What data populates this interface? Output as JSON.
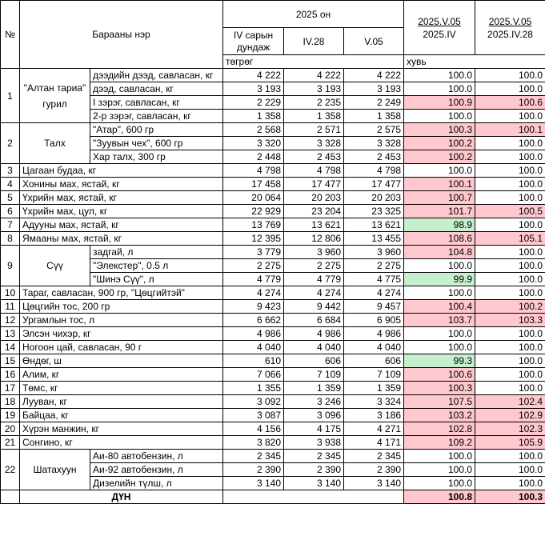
{
  "header": {
    "no": "№",
    "product": "Барааны нэр",
    "year": "2025 он",
    "col_avg": "IV сарын дундаж",
    "col_apr28": "IV.28",
    "col_may05": "V.05",
    "unit_tugrug": "төгрөг",
    "pct1_top": "2025.V.05",
    "pct1_bottom": "2025.IV",
    "pct2_top": "2025.V.05",
    "pct2_bottom": "2025.IV.28",
    "unit_pct": "хувь"
  },
  "groups": {
    "g1_no": "1",
    "g1_name": "\"Алтан тариа\" гурил",
    "g2_no": "2",
    "g2_name": "Талх",
    "g9_no": "9",
    "g9_name": "Сүү",
    "g22_no": "22",
    "g22_name": "Шатахуун"
  },
  "rows": [
    {
      "no": "",
      "name": "дээдийн дээд, савласан, кг",
      "avg": "4 222",
      "apr28": "4 222",
      "may05": "4 222",
      "p1": "100.0",
      "p2": "100.0",
      "c1": "",
      "c2": ""
    },
    {
      "no": "",
      "name": "дээд, савласан, кг",
      "avg": "3 193",
      "apr28": "3 193",
      "may05": "3 193",
      "p1": "100.0",
      "p2": "100.0",
      "c1": "",
      "c2": ""
    },
    {
      "no": "",
      "name": "I зэрэг, савласан, кг",
      "avg": "2 229",
      "apr28": "2 235",
      "may05": "2 249",
      "p1": "100.9",
      "p2": "100.6",
      "c1": "red",
      "c2": "red"
    },
    {
      "no": "",
      "name": "2-р зэрэг, савласан, кг",
      "avg": "1 358",
      "apr28": "1 358",
      "may05": "1 358",
      "p1": "100.0",
      "p2": "100.0",
      "c1": "",
      "c2": ""
    },
    {
      "no": "",
      "name": "\"Атар\", 600 гр",
      "avg": "2 568",
      "apr28": "2 571",
      "may05": "2 575",
      "p1": "100.3",
      "p2": "100.1",
      "c1": "red",
      "c2": "red"
    },
    {
      "no": "",
      "name": "\"Зуувын чех\", 600 гр",
      "avg": "3 320",
      "apr28": "3 328",
      "may05": "3 328",
      "p1": "100.2",
      "p2": "100.0",
      "c1": "red",
      "c2": ""
    },
    {
      "no": "",
      "name": "Хар талх, 300 гр",
      "avg": "2 448",
      "apr28": "2 453",
      "may05": "2 453",
      "p1": "100.2",
      "p2": "100.0",
      "c1": "red",
      "c2": ""
    },
    {
      "no": "3",
      "name": "Цагаан будаа, кг",
      "avg": "4 798",
      "apr28": "4 798",
      "may05": "4 798",
      "p1": "100.0",
      "p2": "100.0",
      "c1": "",
      "c2": ""
    },
    {
      "no": "4",
      "name": "Хонины мах, ястай, кг",
      "avg": "17 458",
      "apr28": "17 477",
      "may05": "17 477",
      "p1": "100.1",
      "p2": "100.0",
      "c1": "red",
      "c2": ""
    },
    {
      "no": "5",
      "name": "Үхрийн мах, ястай, кг",
      "avg": "20 064",
      "apr28": "20 203",
      "may05": "20 203",
      "p1": "100.7",
      "p2": "100.0",
      "c1": "red",
      "c2": ""
    },
    {
      "no": "6",
      "name": "Үхрийн мах, цул, кг",
      "avg": "22 929",
      "apr28": "23 204",
      "may05": "23 325",
      "p1": "101.7",
      "p2": "100.5",
      "c1": "red",
      "c2": "red"
    },
    {
      "no": "7",
      "name": "Адууны мах, ястай, кг",
      "avg": "13 769",
      "apr28": "13 621",
      "may05": "13 621",
      "p1": "98.9",
      "p2": "100.0",
      "c1": "green",
      "c2": ""
    },
    {
      "no": "8",
      "name": "Ямааны мах, ястай, кг",
      "avg": "12 395",
      "apr28": "12 806",
      "may05": "13 455",
      "p1": "108.6",
      "p2": "105.1",
      "c1": "red",
      "c2": "red"
    },
    {
      "no": "",
      "name": "задгай, л",
      "avg": "3 779",
      "apr28": "3 960",
      "may05": "3 960",
      "p1": "104.8",
      "p2": "100.0",
      "c1": "red",
      "c2": ""
    },
    {
      "no": "",
      "name": "\"Элекстер\", 0.5 л",
      "avg": "2 275",
      "apr28": "2 275",
      "may05": "2 275",
      "p1": "100.0",
      "p2": "100.0",
      "c1": "",
      "c2": ""
    },
    {
      "no": "",
      "name": "\"Шинэ Сүү\", л",
      "avg": "4 779",
      "apr28": "4 779",
      "may05": "4 775",
      "p1": "99.9",
      "p2": "100.0",
      "c1": "green",
      "c2": ""
    },
    {
      "no": "10",
      "name": "Тараг, савласан, 900 гр, \"Цөцгийтэй\"",
      "avg": "4 274",
      "apr28": "4 274",
      "may05": "4 274",
      "p1": "100.0",
      "p2": "100.0",
      "c1": "",
      "c2": ""
    },
    {
      "no": "11",
      "name": "Цөцгийн тос, 200 гр",
      "avg": "9 423",
      "apr28": "9 442",
      "may05": "9 457",
      "p1": "100.4",
      "p2": "100.2",
      "c1": "red",
      "c2": "red"
    },
    {
      "no": "12",
      "name": "Ургамлын тос, л",
      "avg": "6 662",
      "apr28": "6 684",
      "may05": "6 905",
      "p1": "103.7",
      "p2": "103.3",
      "c1": "red",
      "c2": "red"
    },
    {
      "no": "13",
      "name": "Элсэн чихэр, кг",
      "avg": "4 986",
      "apr28": "4 986",
      "may05": "4 986",
      "p1": "100.0",
      "p2": "100.0",
      "c1": "",
      "c2": ""
    },
    {
      "no": "14",
      "name": "Ногоон цай, савласан, 90 г",
      "avg": "4 040",
      "apr28": "4 040",
      "may05": "4 040",
      "p1": "100.0",
      "p2": "100.0",
      "c1": "",
      "c2": ""
    },
    {
      "no": "15",
      "name": "Өндөг, ш",
      "avg": "610",
      "apr28": "606",
      "may05": "606",
      "p1": "99.3",
      "p2": "100.0",
      "c1": "green",
      "c2": ""
    },
    {
      "no": "16",
      "name": "Алим, кг",
      "avg": "7 066",
      "apr28": "7 109",
      "may05": "7 109",
      "p1": "100.6",
      "p2": "100.0",
      "c1": "red",
      "c2": ""
    },
    {
      "no": "17",
      "name": "Төмс, кг",
      "avg": "1 355",
      "apr28": "1 359",
      "may05": "1 359",
      "p1": "100.3",
      "p2": "100.0",
      "c1": "red",
      "c2": ""
    },
    {
      "no": "18",
      "name": "Лууван, кг",
      "avg": "3 092",
      "apr28": "3 246",
      "may05": "3 324",
      "p1": "107.5",
      "p2": "102.4",
      "c1": "red",
      "c2": "red"
    },
    {
      "no": "19",
      "name": "Байцаа, кг",
      "avg": "3 087",
      "apr28": "3 096",
      "may05": "3 186",
      "p1": "103.2",
      "p2": "102.9",
      "c1": "red",
      "c2": "red"
    },
    {
      "no": "20",
      "name": "Хүрэн манжин, кг",
      "avg": "4 156",
      "apr28": "4 175",
      "may05": "4 271",
      "p1": "102.8",
      "p2": "102.3",
      "c1": "red",
      "c2": "red"
    },
    {
      "no": "21",
      "name": "Сонгино, кг",
      "avg": "3 820",
      "apr28": "3 938",
      "may05": "4 171",
      "p1": "109.2",
      "p2": "105.9",
      "c1": "red",
      "c2": "red"
    },
    {
      "no": "",
      "name": "Аи-80 автобензин, л",
      "avg": "2 345",
      "apr28": "2 345",
      "may05": "2 345",
      "p1": "100.0",
      "p2": "100.0",
      "c1": "",
      "c2": ""
    },
    {
      "no": "",
      "name": "Аи-92 автобензин, л",
      "avg": "2 390",
      "apr28": "2 390",
      "may05": "2 390",
      "p1": "100.0",
      "p2": "100.0",
      "c1": "",
      "c2": ""
    },
    {
      "no": "",
      "name": "Дизелийн түлш, л",
      "avg": "3 140",
      "apr28": "3 140",
      "may05": "3 140",
      "p1": "100.0",
      "p2": "100.0",
      "c1": "",
      "c2": ""
    }
  ],
  "total": {
    "label": "ДҮН",
    "p1": "100.8",
    "p2": "100.3"
  },
  "colors": {
    "increase": "#ffc7ce",
    "decrease": "#c6efce"
  }
}
